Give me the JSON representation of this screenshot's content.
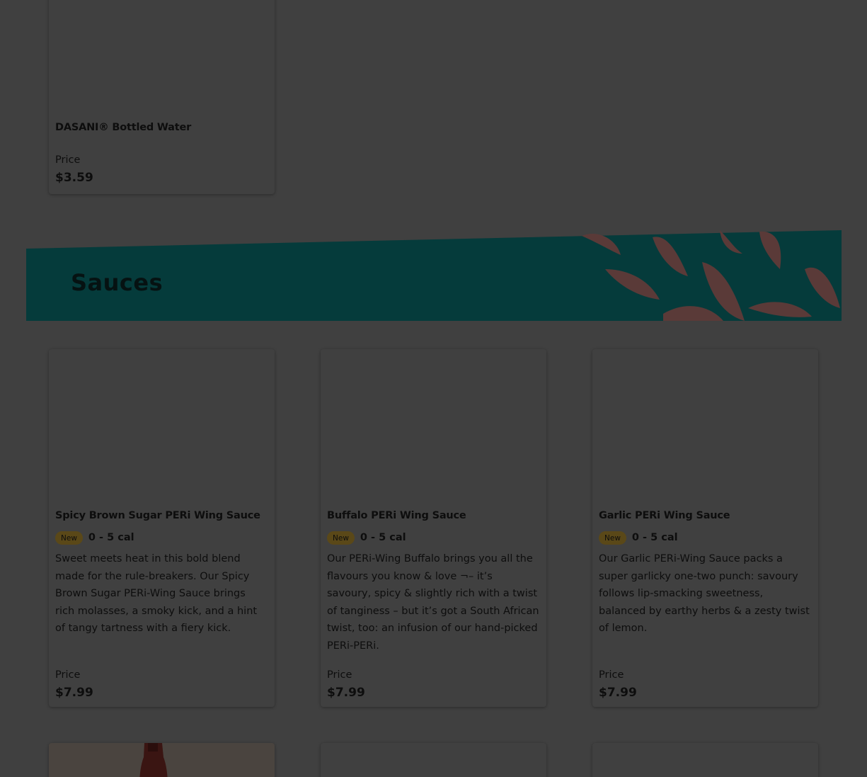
{
  "top_item": {
    "name": "DASANI® Bottled Water",
    "price_label": "Price",
    "price": "$3.59"
  },
  "section": {
    "title": "Sauces",
    "banner_color": "#053b3b",
    "chili_color": "#5a3a38"
  },
  "sauces": [
    {
      "name": "Spicy Brown Sugar PERi Wing Sauce",
      "badge": "New",
      "calories": "0 - 5 cal",
      "description": "Sweet meets heat in this bold blend made for the rule-breakers. Our Spicy Brown Sugar PERi-Wing Sauce brings rich molasses, a smoky kick, and a hint of tangy tartness with a fiery kick.",
      "price_label": "Price",
      "price": "$7.99"
    },
    {
      "name": "Buffalo PERi Wing Sauce",
      "badge": "New",
      "calories": "0 - 5 cal",
      "description": "Our PERi-Wing Buffalo brings you all the flavours you know & love ¬– it’s savoury, spicy & slightly rich with a twist of tanginess – but it’s got a South African twist, too: an infusion of our hand-picked PERi-PERi.",
      "price_label": "Price",
      "price": "$7.99"
    },
    {
      "name": "Garlic PERi Wing Sauce",
      "badge": "New",
      "calories": "0 - 5 cal",
      "description": "Our Garlic PERi-Wing Sauce packs a super garlicky one-two punch: savoury follows lip-smacking sweetness, balanced by earthy herbs & a zesty twist of lemon.",
      "price_label": "Price",
      "price": "$7.99"
    }
  ]
}
